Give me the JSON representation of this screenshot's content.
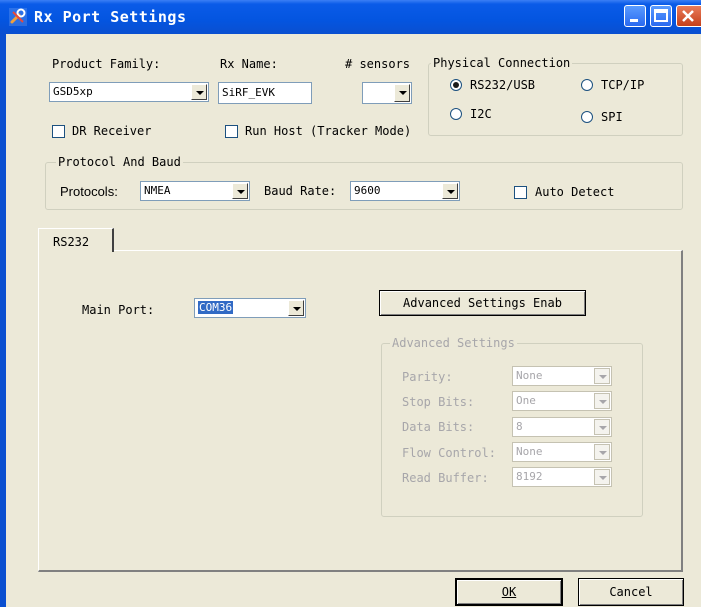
{
  "window": {
    "title": "Rx Port Settings",
    "app_icon": "wrench-icon"
  },
  "top": {
    "product_family_label": "Product Family:",
    "product_family_value": "GSD5xp",
    "rx_name_label": "Rx Name:",
    "rx_name_value": "SiRF_EVK",
    "sensors_label": "# sensors",
    "sensors_value": "",
    "dr_receiver_label": "DR Receiver",
    "run_host_label": "Run Host (Tracker Mode)"
  },
  "physical_connection": {
    "title": "Physical Connection",
    "options": [
      "RS232/USB",
      "TCP/IP",
      "I2C",
      "SPI"
    ],
    "selected": "RS232/USB"
  },
  "protocol": {
    "title": "Protocol And Baud",
    "protocols_label": "Protocols:",
    "protocols_value": "NMEA",
    "baud_label": "Baud Rate:",
    "baud_value": "9600",
    "auto_detect_label": "Auto Detect"
  },
  "tabs": [
    {
      "label": "RS232"
    }
  ],
  "rs232": {
    "main_port_label": "Main Port:",
    "main_port_value": "COM36",
    "advanced_button": "Advanced Settings Enab",
    "advanced_group": {
      "title": "Advanced Settings",
      "rows": [
        {
          "label": "Parity:",
          "value": "None"
        },
        {
          "label": "Stop Bits:",
          "value": "One"
        },
        {
          "label": "Data Bits:",
          "value": "8"
        },
        {
          "label": "Flow Control:",
          "value": "None"
        },
        {
          "label": "Read Buffer:",
          "value": "8192"
        }
      ]
    }
  },
  "footer": {
    "ok": "OK",
    "cancel": "Cancel"
  }
}
